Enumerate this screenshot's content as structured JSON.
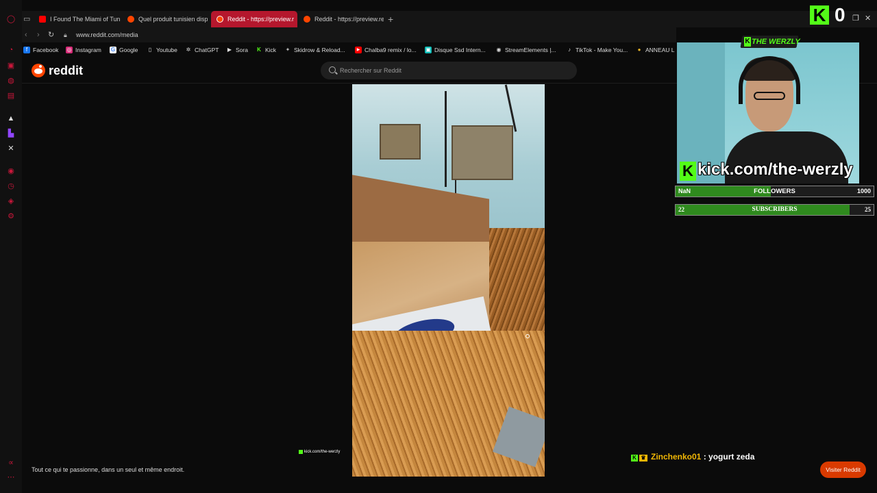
{
  "tabs": [
    {
      "label": "I Found The Miami of Tun",
      "favicon_color": "#ff0000"
    },
    {
      "label": "Quel produit tunisien disp",
      "favicon_color": "#ff4500"
    },
    {
      "label": "Reddit - https://preview.r",
      "favicon_color": "#ff4500",
      "active": true
    },
    {
      "label": "Reddit - https://preview.re",
      "favicon_color": "#ff4500"
    }
  ],
  "new_tab_symbol": "+",
  "address": {
    "url": "www.reddit.com/media"
  },
  "bookmarks": [
    {
      "label": "Facebook",
      "icon": "facebook-icon",
      "color": "#1877f2",
      "glyph": "f"
    },
    {
      "label": "Instagram",
      "icon": "instagram-icon",
      "color": "#d62976",
      "glyph": "◎"
    },
    {
      "label": "Google",
      "icon": "google-icon",
      "color": "#ffffff",
      "glyph": "G"
    },
    {
      "label": "Youtube",
      "icon": "document-icon",
      "color": "#333333",
      "glyph": "▯"
    },
    {
      "label": "ChatGPT",
      "icon": "chatgpt-icon",
      "color": "#333333",
      "glyph": "✲"
    },
    {
      "label": "Sora",
      "icon": "sora-icon",
      "color": "#333333",
      "glyph": "▶"
    },
    {
      "label": "Kick",
      "icon": "kick-icon",
      "color": "#53fc18",
      "glyph": "K"
    },
    {
      "label": "Skidrow & Reload...",
      "icon": "skidrow-icon",
      "color": "#555555",
      "glyph": "✦"
    },
    {
      "label": "Chalba9 remix / lo...",
      "icon": "youtube-icon",
      "color": "#ff0000",
      "glyph": "▶"
    },
    {
      "label": "Disque Ssd Intern...",
      "icon": "store-icon",
      "color": "#0abab5",
      "glyph": "▣"
    },
    {
      "label": "StreamElements |...",
      "icon": "streamelements-icon",
      "color": "#444444",
      "glyph": "◉"
    },
    {
      "label": "TikTok - Make You...",
      "icon": "tiktok-icon",
      "color": "#111111",
      "glyph": "♪"
    },
    {
      "label": "ANNEAU L",
      "icon": "ring-icon",
      "color": "#e3b127",
      "glyph": "●"
    }
  ],
  "reddit": {
    "wordmark": "reddit",
    "search_placeholder": "Rechercher sur Reddit",
    "tagline": "Tout ce qui te passionne, dans un seul et même endroit.",
    "visit_button": "Visiter Reddit",
    "brand_color": "#ff4500"
  },
  "overlay": {
    "kick_count": "0",
    "cam_name": "THE WERZLY",
    "kick_url": "kick.com/the-werzly",
    "watermark": "kick.com/the-werzly",
    "followers": {
      "left": "NaN",
      "title": "FOLLOWERS",
      "right": "1000",
      "progress": 0.48
    },
    "subscribers": {
      "left": "22",
      "title": "SUBSCRIBERS",
      "right": "25",
      "progress": 0.88
    },
    "accent": "#53fc18"
  },
  "chat": {
    "user": "Zinchenko01",
    "separator": ":",
    "message": "yogurt zeda"
  }
}
